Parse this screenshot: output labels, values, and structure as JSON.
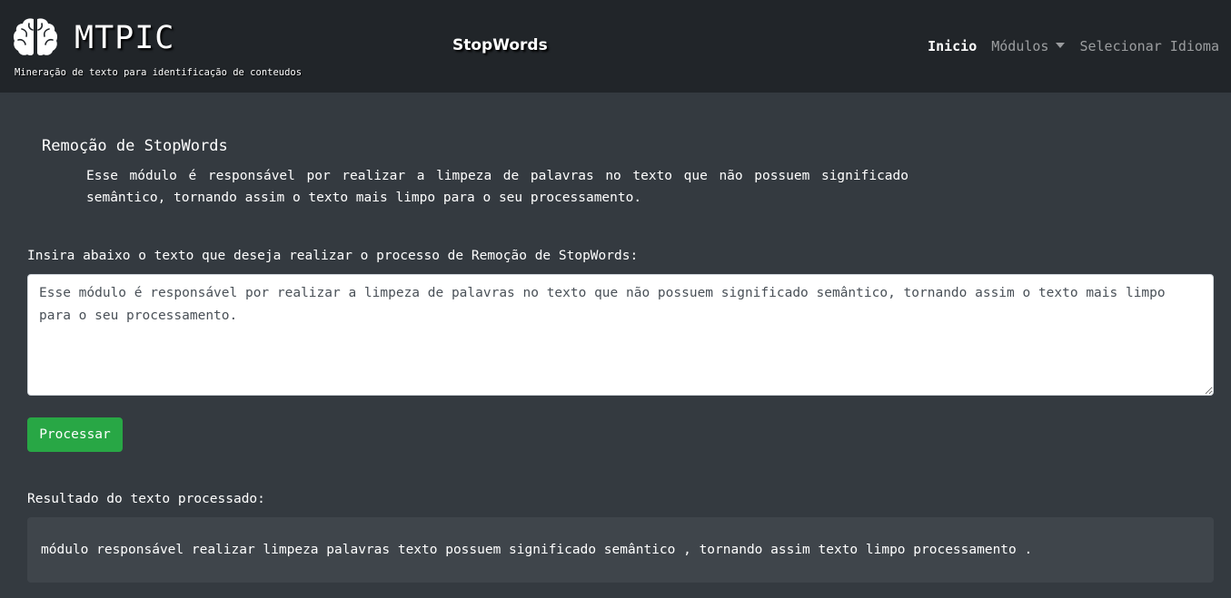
{
  "navbar": {
    "brand_name": "MTPIC",
    "brand_tagline": "Mineração de texto para identificação de conteudos",
    "logo_icon": "brain-icon",
    "center_title": "StopWords",
    "links": {
      "home": "Inicio",
      "modules": "Módulos",
      "language": "Selecionar Idioma"
    }
  },
  "main": {
    "title": "Remoção de StopWords",
    "description": "Esse módulo é responsável por realizar a limpeza de palavras no texto que não possuem significado semântico, tornando assim o texto mais limpo para o seu processamento.",
    "input_label": "Insira abaixo o texto que deseja realizar o processo de Remoção de StopWords:",
    "input_value": "Esse módulo é responsável por realizar a limpeza de palavras no texto que não possuem significado semântico, tornando assim o texto mais limpo para o seu processamento.",
    "process_button": "Processar",
    "result_label": "Resultado do texto processado:",
    "result_text": "módulo responsável realizar limpeza palavras texto possuem significado semântico , tornando assim texto limpo processamento ."
  },
  "colors": {
    "navbar_bg": "#212529",
    "page_bg": "#343a40",
    "button_green": "#28a745",
    "result_bg": "#3f454b"
  }
}
